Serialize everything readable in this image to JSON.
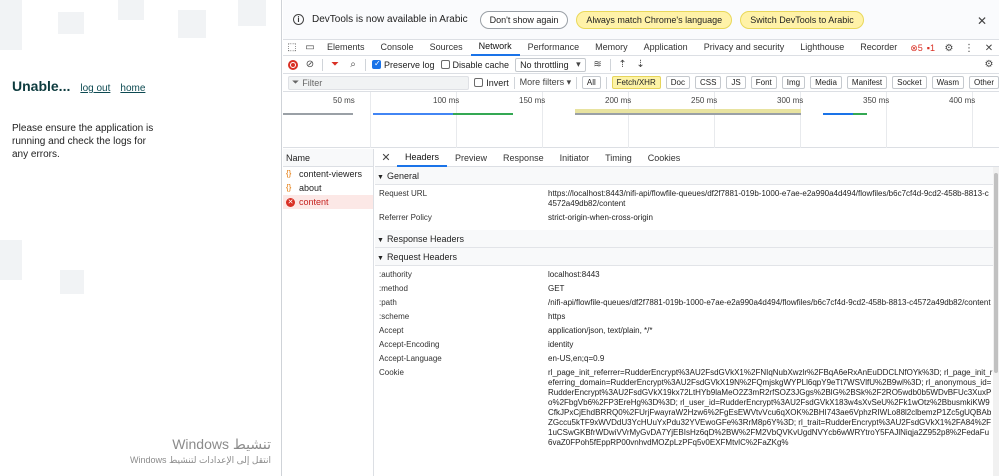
{
  "page": {
    "title": "Unable...",
    "links": [
      "log out",
      "home"
    ],
    "message": "Please ensure the application is running and check the logs for any errors."
  },
  "windows_watermark": {
    "line1": "تنشيط Windows",
    "line2": "انتقل إلى الإعدادات لتنشيط Windows"
  },
  "infobar": {
    "text": "DevTools is now available in Arabic",
    "buttons": [
      "Don't show again",
      "Always match Chrome's language",
      "Switch DevTools to Arabic"
    ]
  },
  "tabs": [
    "Elements",
    "Console",
    "Sources",
    "Network",
    "Performance",
    "Memory",
    "Application",
    "Privacy and security",
    "Lighthouse",
    "Recorder"
  ],
  "active_tab": "Network",
  "badges": {
    "errors": "5",
    "warnings": "1"
  },
  "network_toolbar": {
    "preserve_log": "Preserve log",
    "disable_cache": "Disable cache",
    "throttling": "No throttling"
  },
  "filter_bar": {
    "placeholder": "Filter",
    "invert": "Invert",
    "more_filters": "More filters",
    "types": [
      "All",
      "Fetch/XHR",
      "Doc",
      "CSS",
      "JS",
      "Font",
      "Img",
      "Media",
      "Manifest",
      "Socket",
      "Wasm",
      "Other"
    ],
    "active_type": "Fetch/XHR"
  },
  "timeline": {
    "ticks": [
      "50 ms",
      "100 ms",
      "150 ms",
      "200 ms",
      "250 ms",
      "300 ms",
      "350 ms",
      "400 ms"
    ]
  },
  "requests": {
    "header": "Name",
    "items": [
      {
        "name": "content-viewers",
        "status": "ok"
      },
      {
        "name": "about",
        "status": "ok"
      },
      {
        "name": "content",
        "status": "error"
      }
    ]
  },
  "detail_tabs": [
    "Headers",
    "Preview",
    "Response",
    "Initiator",
    "Timing",
    "Cookies"
  ],
  "active_detail_tab": "Headers",
  "general": {
    "title": "General",
    "rows": [
      {
        "k": "Request URL",
        "v": "https://localhost:8443/nifi-api/flowfile-queues/df2f7881-019b-1000-e7ae-e2a990a4d494/flowfiles/b6c7cf4d-9cd2-458b-8813-c4572a49db82/content"
      },
      {
        "k": "Referrer Policy",
        "v": "strict-origin-when-cross-origin"
      }
    ]
  },
  "response_headers": {
    "title": "Response Headers"
  },
  "request_headers": {
    "title": "Request Headers",
    "rows": [
      {
        "k": ":authority",
        "v": "localhost:8443"
      },
      {
        "k": ":method",
        "v": "GET"
      },
      {
        "k": ":path",
        "v": "/nifi-api/flowfile-queues/df2f7881-019b-1000-e7ae-e2a990a4d494/flowfiles/b6c7cf4d-9cd2-458b-8813-c4572a49db82/content"
      },
      {
        "k": ":scheme",
        "v": "https"
      },
      {
        "k": "Accept",
        "v": "application/json, text/plain, */*"
      },
      {
        "k": "Accept-Encoding",
        "v": "identity"
      },
      {
        "k": "Accept-Language",
        "v": "en-US,en;q=0.9"
      },
      {
        "k": "Cookie",
        "v": "rl_page_init_referrer=RudderEncrypt%3AU2FsdGVkX1%2FNIqNubXwzlr%2FBqA6eRxAnEuDDCLNfOYk%3D; rl_page_init_referring_domain=RudderEncrypt%3AU2FsdGVkX19N%2FQmjskgWYPLl6qpY9eTt7WSVlfU%2B9wl%3D; rl_anonymous_id=RudderEncrypt%3AU2FsdGVkX19kx72LtHYb9laMeO2Z3mR2rfSOZ3JGgs%2BlG%2BSk%2F2RO5wdb0b5WDvBFUc3XuxPo%2FbgVb6%2FP3EreHg%3D%3D; rl_user_id=RudderEncrypt%3AU2FsdGVkX183w4sXvSeU%2Fk1wOtz%2BbusmkiKW9CfkJPxCjEhdBRRQ0%2FUrjFwayraW2Hzw6%2FgEsEWVtvVcu6qXOK%2BHI743ae6VphzRIWLo88l2clbemzP1Zc5gUQBAbZGccu5kTF9xWVDdU3YcHUuYxPdu32YVEwoGFe%3RrM8p6Y%3D; rl_trait=RudderEncrypt%3AU2FsdGVkX1%2FA84%2F1uCSwGKBfrWDwiVVrMyGvDA7YjEBIsHz6qD%2BW%2FM2VbQVKvUgdNVYcb6wWRYtroY5FAJlNiqja2Z952p8%2FedaFu6vaZ0FPoh5fEppRP00vnhvdMOZpLzPFq5v0EXFMtvlC%2FaZKg%"
      }
    ]
  },
  "colors": {
    "accent": "#1a73e8",
    "error": "#d93025",
    "highlight": "#fff2a8",
    "title": "#0d3b3e"
  }
}
